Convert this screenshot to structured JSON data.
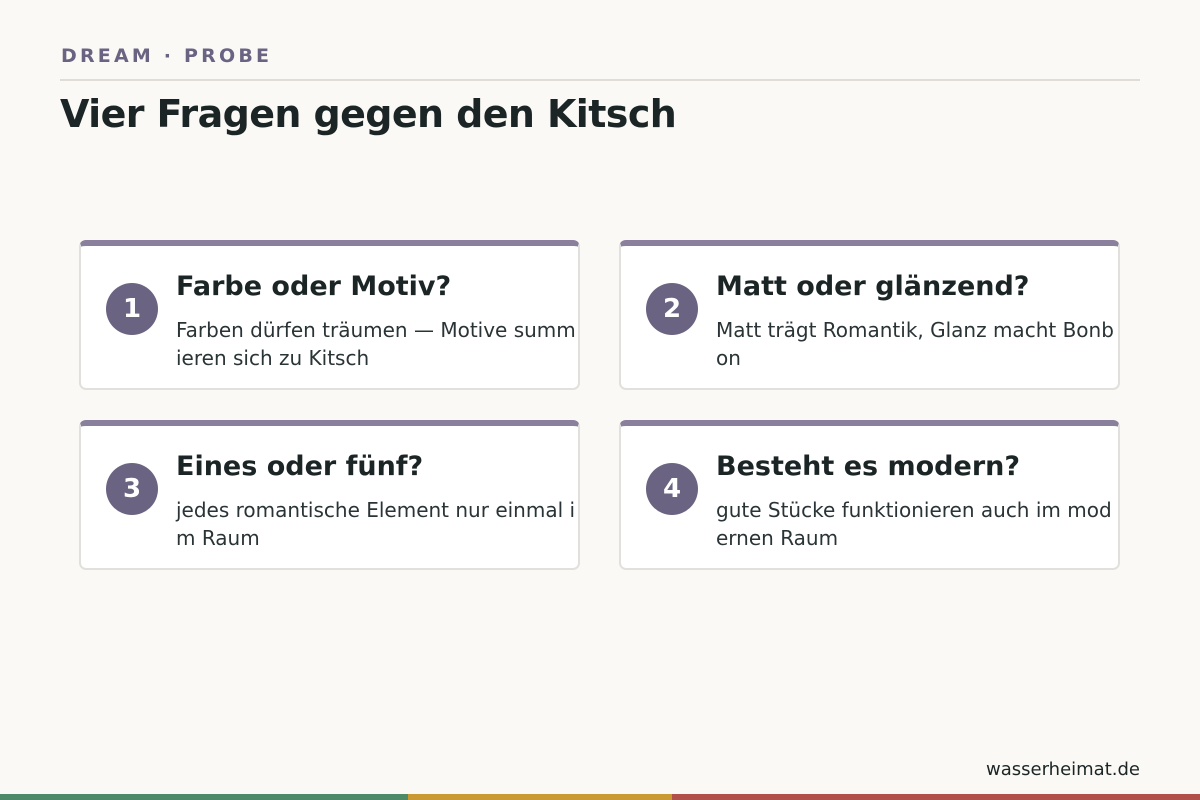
{
  "header": {
    "kicker": "DREAM · PROBE",
    "title": "Vier Fragen gegen den Kitsch"
  },
  "cards": [
    {
      "number": "1",
      "question": "Farbe oder Motiv?",
      "answer": "Farben dürfen träumen — Motive summieren sich zu Kitsch"
    },
    {
      "number": "2",
      "question": "Matt oder glänzend?",
      "answer": "Matt trägt Romantik, Glanz macht Bonbon"
    },
    {
      "number": "3",
      "question": "Eines oder fünf?",
      "answer": "jedes romantische Element nur einmal im Raum"
    },
    {
      "number": "4",
      "question": "Besteht es modern?",
      "answer": "gute Stücke funktionieren auch im modernen Raum"
    }
  ],
  "footer": {
    "site": "wasserheimat.de"
  },
  "colors": {
    "accent": "#6b6382",
    "card_top_border": "#8a7f9c",
    "stripe": [
      "#4e8a68",
      "#c99a34",
      "#b0504a"
    ]
  }
}
